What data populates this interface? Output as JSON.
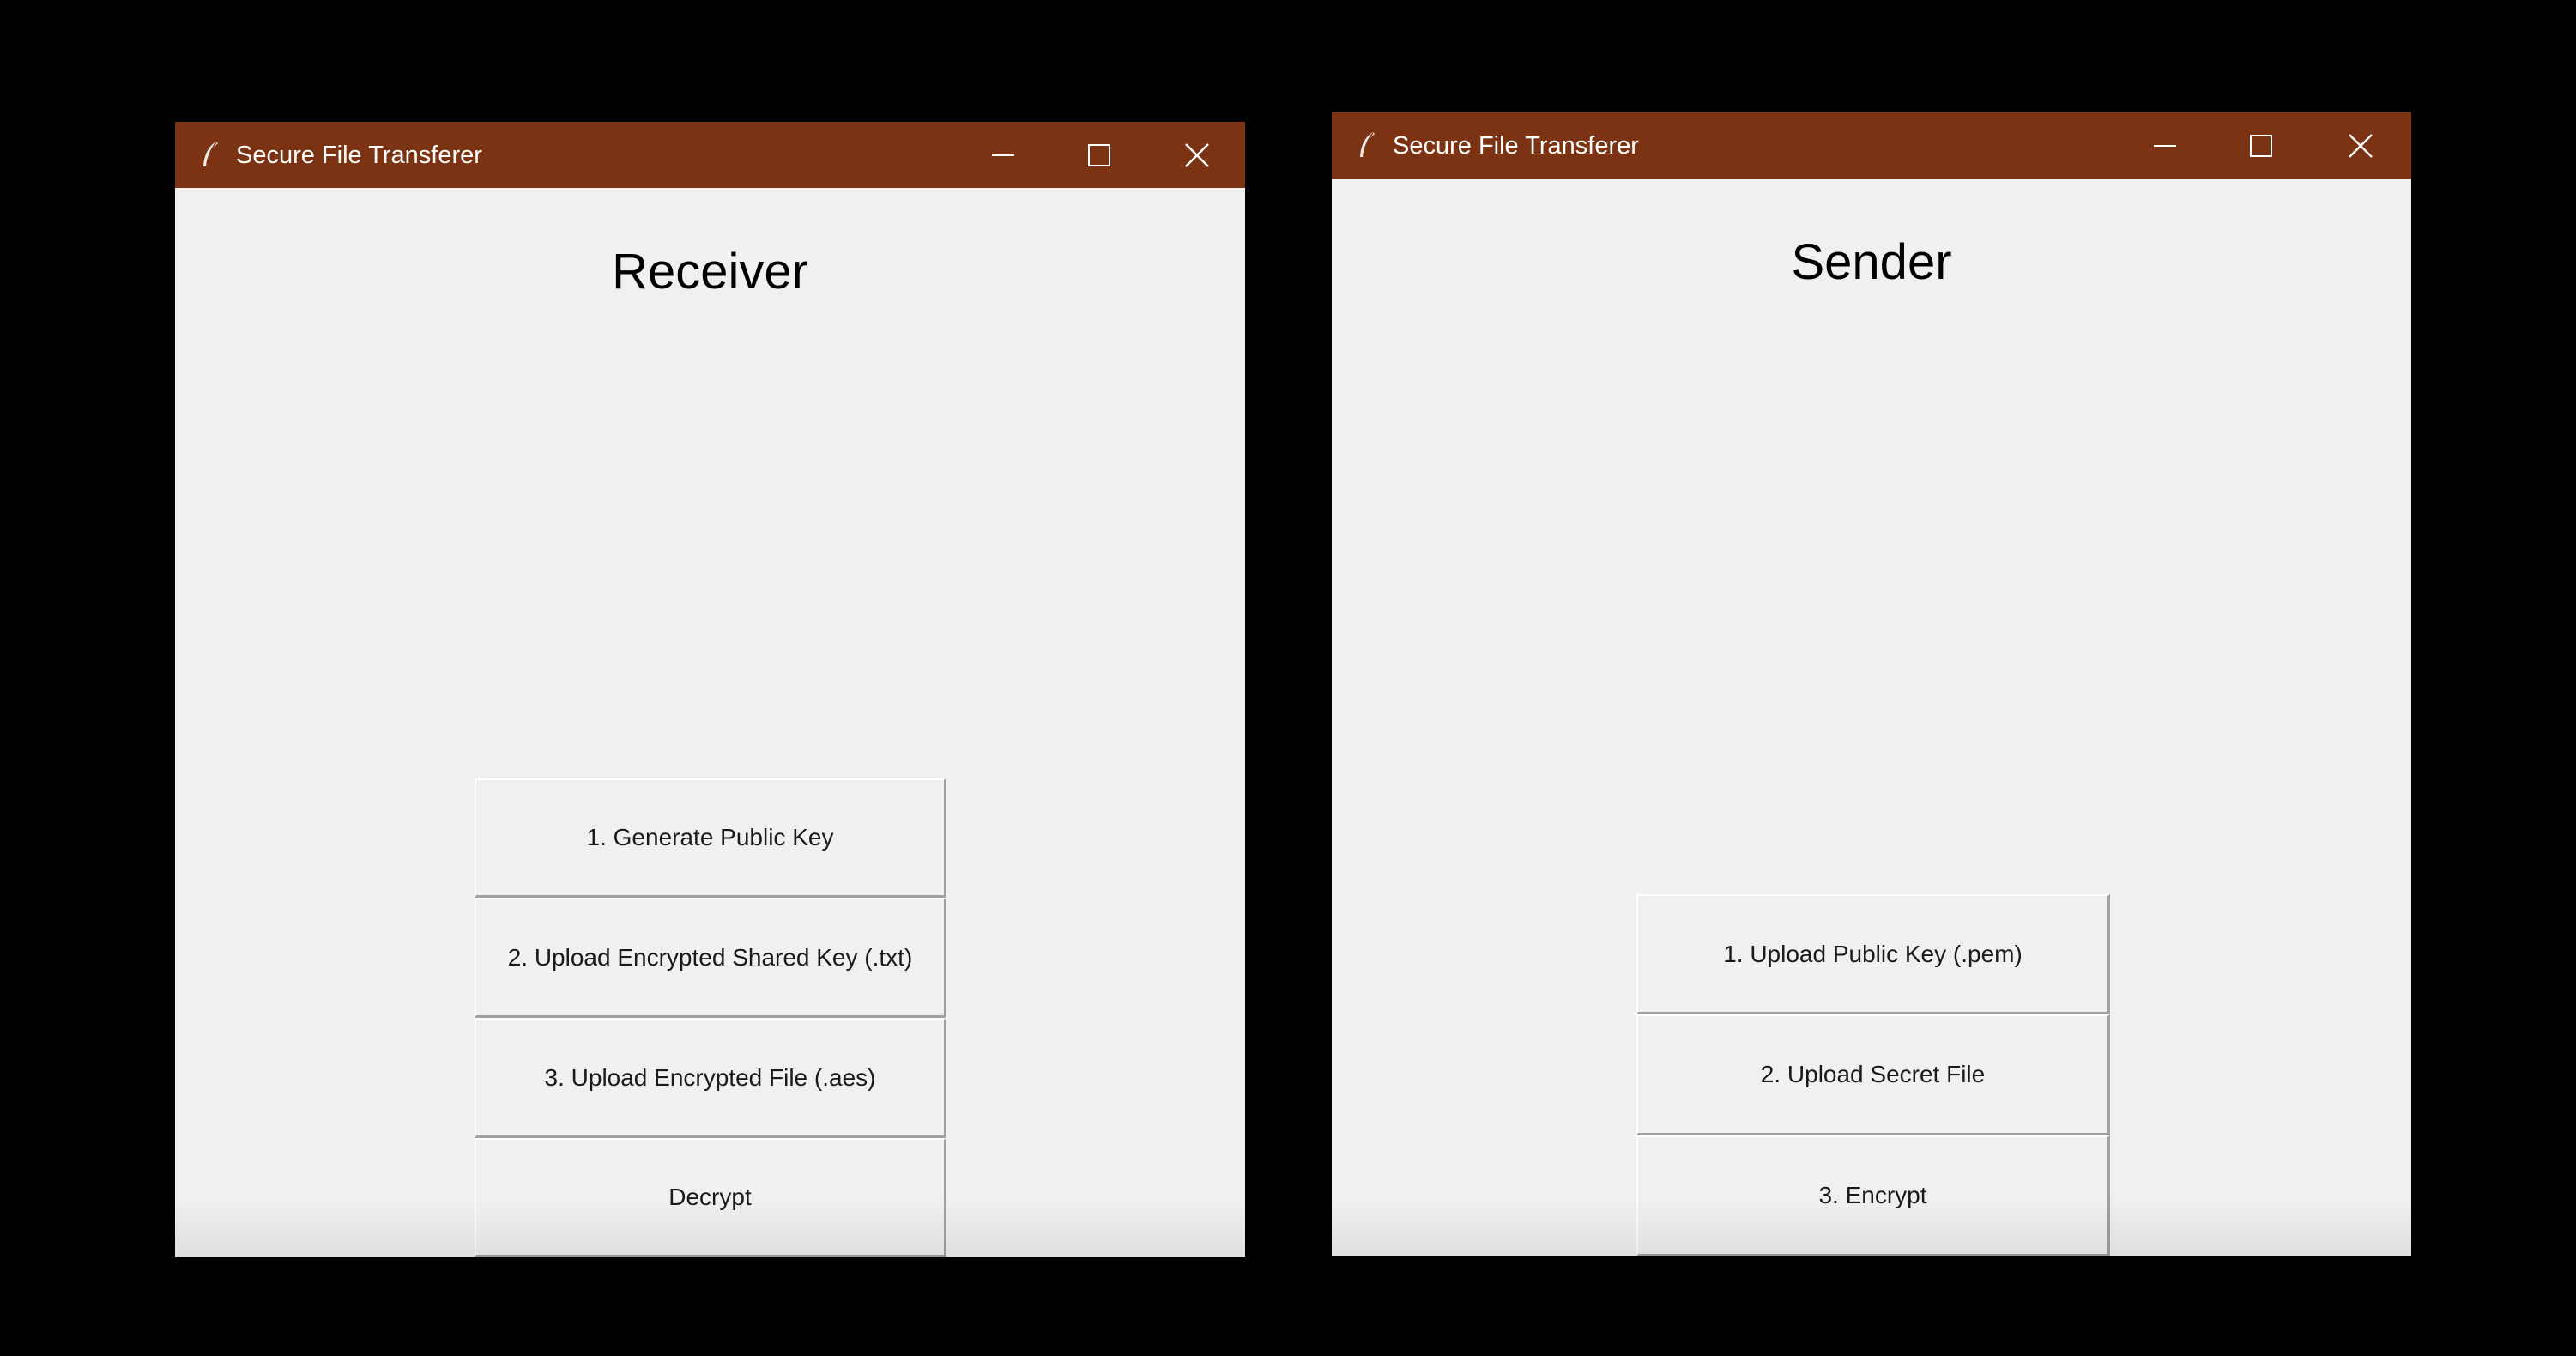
{
  "receiver_window": {
    "title": "Secure File Transferer",
    "heading": "Receiver",
    "buttons": [
      {
        "label": "1. Generate Public Key"
      },
      {
        "label": "2. Upload Encrypted Shared Key (.txt)"
      },
      {
        "label": "3. Upload Encrypted File (.aes)"
      },
      {
        "label": "Decrypt"
      }
    ]
  },
  "sender_window": {
    "title": "Secure File Transferer",
    "heading": "Sender",
    "buttons": [
      {
        "label": "1. Upload Public Key (.pem)"
      },
      {
        "label": "2. Upload Secret File"
      },
      {
        "label": "3. Encrypt"
      }
    ]
  },
  "icons": {
    "app": "feather-icon",
    "minimize": "minimize-icon",
    "maximize": "maximize-icon",
    "close": "close-icon"
  },
  "colors": {
    "titlebar": "#7c3313",
    "window_bg": "#f0f0f0",
    "desktop_bg": "#000000"
  }
}
